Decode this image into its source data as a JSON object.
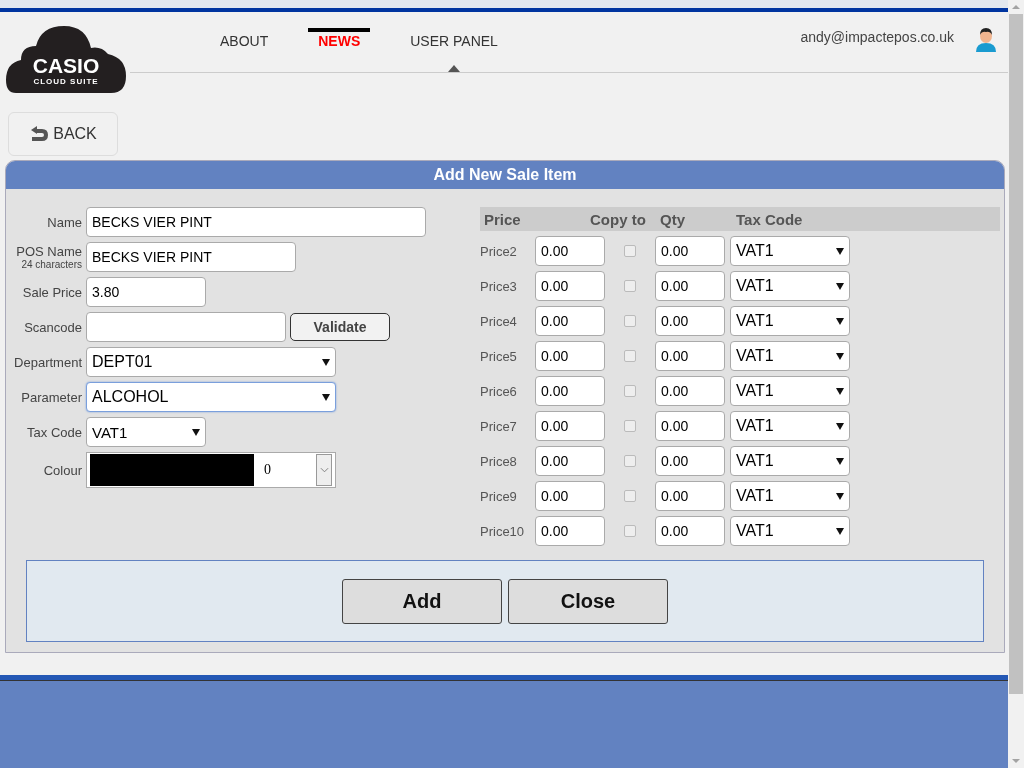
{
  "nav": [
    {
      "label": "ABOUT",
      "selected": false,
      "current": false
    },
    {
      "label": "NEWS",
      "selected": true,
      "current": false
    },
    {
      "label": "USER PANEL",
      "selected": false,
      "current": true
    }
  ],
  "logo": {
    "title": "CASIO",
    "subtitle": "CLOUD SUITE"
  },
  "user": {
    "email": "andy@impactepos.co.uk"
  },
  "back_button": "BACK",
  "dialog": {
    "title": "Add New Sale Item",
    "fields": [
      {
        "kind": "text",
        "label": "Name",
        "value": "BECKS VIER PINT"
      },
      {
        "kind": "text",
        "label": "POS Name",
        "sublabel": "24 characters",
        "value": "BECKS VIER PINT"
      },
      {
        "kind": "text",
        "label": "Sale Price",
        "value": "3.80"
      },
      {
        "kind": "scan",
        "label": "Scancode",
        "button": "Validate"
      },
      {
        "kind": "select",
        "label": "Department",
        "value": "DEPT01"
      },
      {
        "kind": "select",
        "label": "Parameter",
        "value": "ALCOHOL",
        "focused": true
      },
      {
        "kind": "select",
        "label": "Tax Code",
        "value": "VAT1"
      },
      {
        "kind": "colour",
        "label": "Colour",
        "color": "#000000",
        "value": "0"
      }
    ],
    "price_columns": [
      "Price",
      "Copy to",
      "Qty",
      "Tax Code"
    ],
    "prices": [
      {
        "label": "Price2",
        "price": "0.00",
        "checked": false,
        "qty": "0.00",
        "tax": "VAT1"
      },
      {
        "label": "Price3",
        "price": "0.00",
        "checked": false,
        "qty": "0.00",
        "tax": "VAT1"
      },
      {
        "label": "Price4",
        "price": "0.00",
        "checked": false,
        "qty": "0.00",
        "tax": "VAT1"
      },
      {
        "label": "Price5",
        "price": "0.00",
        "checked": false,
        "qty": "0.00",
        "tax": "VAT1"
      },
      {
        "label": "Price6",
        "price": "0.00",
        "checked": false,
        "qty": "0.00",
        "tax": "VAT1"
      },
      {
        "label": "Price7",
        "price": "0.00",
        "checked": false,
        "qty": "0.00",
        "tax": "VAT1"
      },
      {
        "label": "Price8",
        "price": "0.00",
        "checked": false,
        "qty": "0.00",
        "tax": "VAT1"
      },
      {
        "label": "Price9",
        "price": "0.00",
        "checked": false,
        "qty": "0.00",
        "tax": "VAT1"
      },
      {
        "label": "Price10",
        "price": "0.00",
        "checked": false,
        "qty": "0.00",
        "tax": "VAT1"
      }
    ],
    "buttons": [
      "Add",
      "Close"
    ]
  }
}
